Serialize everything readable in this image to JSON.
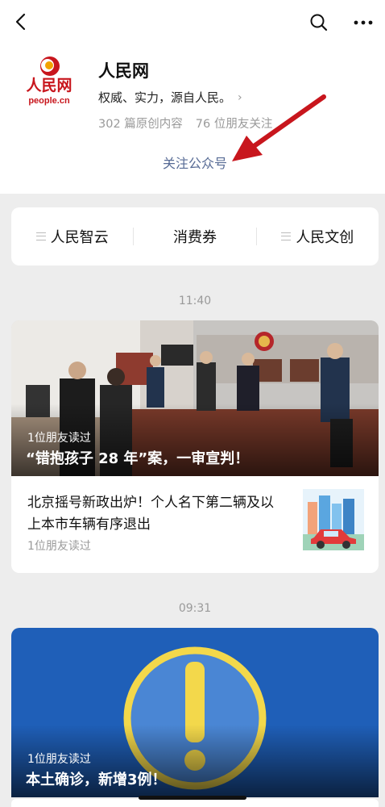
{
  "nav": {
    "back_icon": "chevron-left-icon",
    "search_icon": "search-icon",
    "more_icon": "more-dots-icon"
  },
  "account": {
    "name": "人民网",
    "logo_text": "人民网",
    "logo_domain": "people.cn",
    "description": "权威、实力，源自人民。",
    "original_count": "302 篇原创内容",
    "friends_follow": "76 位朋友关注",
    "follow_label": "关注公众号"
  },
  "menu": {
    "items": [
      {
        "label": "人民智云"
      },
      {
        "label": "消费券"
      },
      {
        "label": "人民文创"
      }
    ]
  },
  "groups": [
    {
      "time": "11:40",
      "main": {
        "read": "1位朋友读过",
        "title": "“错抱孩子 28 年”案，一审宣判！"
      },
      "sub": {
        "title": "北京摇号新政出炉！个人名下第二辆及以上本市车辆有序退出",
        "read": "1位朋友读过"
      }
    },
    {
      "time": "09:31",
      "main": {
        "read": "1位朋友读过",
        "title": "本土确诊，新增3例！"
      }
    }
  ],
  "colors": {
    "link": "#576b95",
    "bg": "#ededed",
    "accent_red": "#c8161d",
    "alert_yellow": "#f3d84b",
    "alert_blue": "#1f5fb8"
  }
}
